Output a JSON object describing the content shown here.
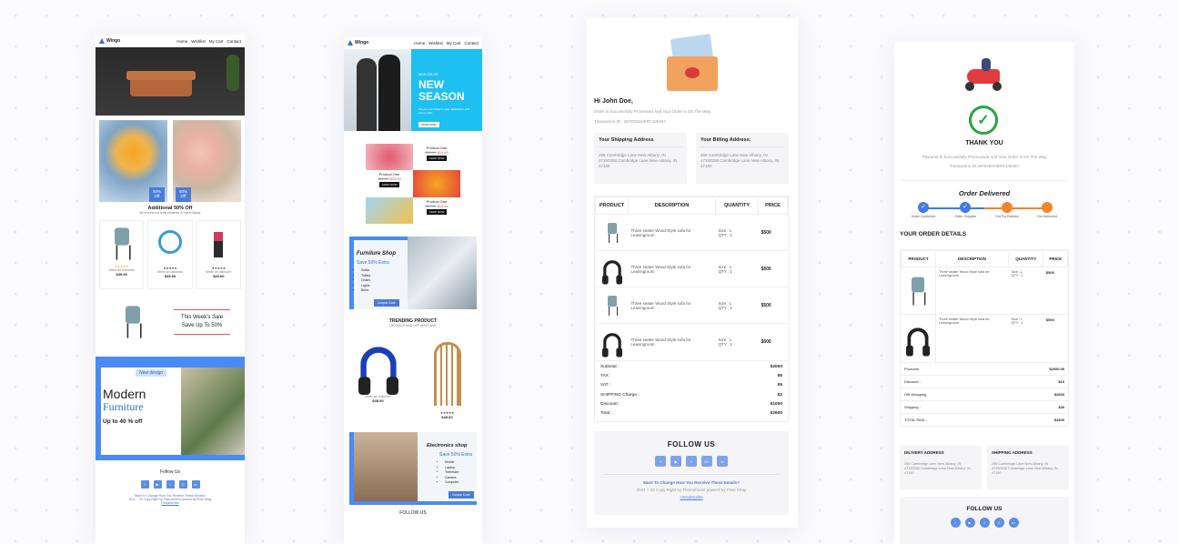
{
  "brand": {
    "name": "Wingo",
    "accent": "#4a7bd8",
    "sky": "#1ec0f2"
  },
  "nav": [
    "Home",
    "Wishlist",
    "My Cart",
    "Contact"
  ],
  "t1": {
    "promo_title": "Additional 50% Off",
    "promo_sub": "Be chicfrea for bulls posteran & Harve Barae",
    "badge_pct": "50%",
    "badge_off": "Off",
    "products": [
      {
        "name": "When an unknown",
        "price": "$45.00",
        "icon": "chair-icon"
      },
      {
        "name": "When an unknown",
        "price": "$45.00",
        "icon": "fan-icon"
      },
      {
        "name": "When an unknown",
        "price": "$45.00",
        "icon": "plant-icon"
      }
    ],
    "stars": "★★★★★",
    "sale_line1": "This Week's Sale",
    "sale_line2": "Save Up To 50%",
    "banner_tag": "New design",
    "banner_l1": "Modern",
    "banner_l2": "Furniture",
    "banner_l3": "Up to 40 % off",
    "follow": "Follow Us",
    "footer_link": "Want To Change How You Receive These Emails?",
    "footer_copy": "2021 ~ 22 Copy Right by Themeforest powerd by Pixel Strap",
    "unsubscribe": "Unsubscribe"
  },
  "t2": {
    "hero_small": "NEW COLOR",
    "hero_l1": "NEW",
    "hero_l2": "SEASON",
    "hero_desc": "We are committed to your satisfaction with every order.",
    "hero_btn": "SHOP NOW",
    "prod_label": "Product One",
    "prod_old": "$28.00",
    "prod_new": "$20.60",
    "prod_new_alt": "$19.60",
    "prod_btn": "SHOP NOW",
    "furn_title": "Furniture Shop",
    "furn_save": "Save 50% Extra",
    "furn_items": [
      "Sofas",
      "Tables",
      "Chairs",
      "Lights",
      "Beds"
    ],
    "furn_btn": "Coupon Code",
    "trending": "TRENDING PRODUCT",
    "trending_sub": "GET BACK AND OFF DISCOUNT",
    "trend_name": "When an unknown",
    "trend_price": "$45.00",
    "stars": "★★★★★",
    "elec_title": "Electronics shop",
    "elec_save": "Save 50% Extra",
    "elec_items": [
      "Mobile",
      "Laptop",
      "Television",
      "Camera",
      "Computer"
    ],
    "elec_btn": "Coupon Code",
    "follow": "FOLLOW US"
  },
  "t3": {
    "greeting": "Hi John Doe,",
    "msg": "Order Is Successfully Processed And Your Order Is On The Way,",
    "txn": "Transaction ID : 267876GHERY105467,",
    "ship_title": "Your Shipping Address",
    "bill_title": "Your Billing Address:",
    "address": "268 Cambridge Lane New Albany, IN 47150268 Cambridge Lane New Albany, IN 47150",
    "headers": [
      "PRODUCT",
      "DESCRIPTION",
      "QUANTITY",
      "PRICE"
    ],
    "rows": [
      {
        "icon": "chair-icon",
        "desc": "Three seater Wood Style sofa for Leavingroom",
        "size": "Size : L",
        "qty": "QTY : 1",
        "price": "$500"
      },
      {
        "icon": "headphones-icon",
        "desc": "Three seater Wood Style sofa for Leavingroom",
        "size": "Size : L",
        "qty": "QTY : 1",
        "price": "$500"
      },
      {
        "icon": "chair-icon",
        "desc": "Three seater Wood Style sofa for Leavingroom",
        "size": "Size : L",
        "qty": "QTY : 1",
        "price": "$500"
      },
      {
        "icon": "headphones-icon",
        "desc": "Three seater Wood Style sofa for Leavingroom",
        "size": "Size : L",
        "qty": "QTY : 1",
        "price": "$500"
      }
    ],
    "summary": [
      {
        "label": "Subtotal :",
        "value": "$2000"
      },
      {
        "label": "TAX :",
        "value": "$5"
      },
      {
        "label": "VAT :",
        "value": "$5"
      },
      {
        "label": "SHIPPING Charge :",
        "value": "$2"
      },
      {
        "label": "Discount :",
        "value": "$1000"
      },
      {
        "label": "Total :",
        "value": "$2600"
      }
    ],
    "follow": "FOLLOW US",
    "footer_link": "Want To Change How You Receive These Emails?",
    "footer_copy": "2021 ~ 22 Copy Right by Themeforest powerd by Pixel Strap",
    "unsubscribe": "Unsubscribe"
  },
  "t4": {
    "thank": "THANK YOU",
    "msg": "Payment Is Successfully Processsed And Your Order Is On The Way",
    "txn": "Transaction ID:267676GHERT105467",
    "status_title": "Order Delivered",
    "steps": [
      "Order Confirmed",
      "Order Shipped",
      "Out For Delivery",
      "Got Delivered"
    ],
    "step_colors": [
      "#3f7be3",
      "#3f7be3",
      "#f0852c",
      "#f0852c"
    ],
    "details_title": "YOUR ORDER DETAILS",
    "headers": [
      "PRODUCT",
      "DESCRIPTION",
      "QUANTITY",
      "PRICE"
    ],
    "rows": [
      {
        "icon": "chair-icon",
        "desc": "Three seater Wood Style sofa for Leavingroom",
        "size": "Size : L",
        "qty": "QTY : 1",
        "price": "$500"
      },
      {
        "icon": "headphones-icon",
        "desc": "Three seater Wood Style sofa for Leavingroom",
        "size": "Size : L",
        "qty": "QTY : 1",
        "price": "$500"
      }
    ],
    "summary": [
      {
        "label": "Products",
        "value": "$2600.00"
      },
      {
        "label": "Discount :",
        "value": "$10"
      },
      {
        "label": "Gift Wrapping",
        "value": "$2600"
      },
      {
        "label": "Shipping :",
        "value": "$30"
      },
      {
        "label": "TOTAL PAID :",
        "value": "$2600"
      }
    ],
    "deliv_title": "DILIVERY ADDRESS",
    "ship_title": "SHIPPING ADDRESS",
    "address": "268 Cambridge Lane New Albany, IN 47150268 Cambridge Lane New Albany, IN 47150",
    "follow": "FOLLOW US"
  }
}
